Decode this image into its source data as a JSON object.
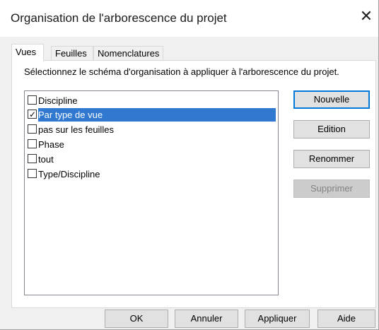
{
  "window": {
    "title": "Organisation de l'arborescence du projet",
    "close_glyph": "✕"
  },
  "tabs": [
    {
      "label": "Vues",
      "active": true
    },
    {
      "label": "Feuilles",
      "active": false
    },
    {
      "label": "Nomenclatures",
      "active": false
    }
  ],
  "panel": {
    "instruction": "Sélectionnez le schéma d'organisation à appliquer à l'arborescence du projet."
  },
  "schemes": [
    {
      "label": "Discipline",
      "checked": false,
      "selected": false
    },
    {
      "label": "Par type de vue",
      "checked": true,
      "selected": true
    },
    {
      "label": "pas sur les feuilles",
      "checked": false,
      "selected": false
    },
    {
      "label": "Phase",
      "checked": false,
      "selected": false
    },
    {
      "label": "tout",
      "checked": false,
      "selected": false
    },
    {
      "label": "Type/Discipline",
      "checked": false,
      "selected": false
    }
  ],
  "side_buttons": {
    "new": "Nouvelle",
    "edit": "Edition",
    "rename": "Renommer",
    "delete": "Supprimer"
  },
  "footer": {
    "ok": "OK",
    "cancel": "Annuler",
    "apply": "Appliquer",
    "help": "Aide"
  },
  "colors": {
    "selection": "#3078d0",
    "default_button_border": "#0078d7"
  },
  "icons": {
    "close": "close-icon",
    "check": "checkmark-icon"
  }
}
